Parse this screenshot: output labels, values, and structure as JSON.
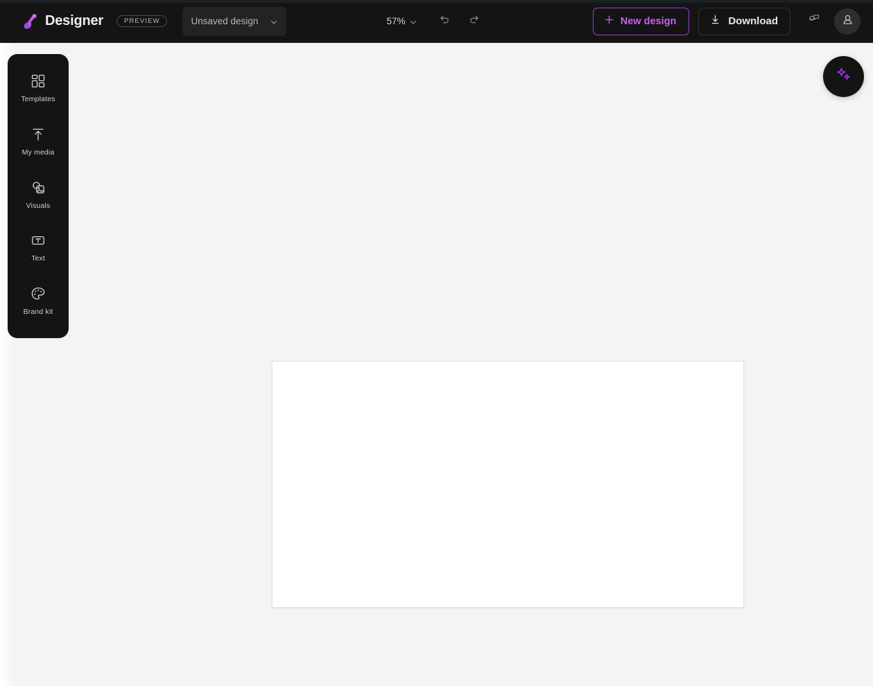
{
  "app": {
    "logo_icon": "designer-logo-icon",
    "name": "Designer",
    "preview_badge": "PREVIEW"
  },
  "topbar": {
    "design_name": "Unsaved design",
    "design_dropdown_icon": "chevron-down-icon",
    "zoom_level": "57%",
    "zoom_dropdown_icon": "chevron-down-icon",
    "undo_icon": "undo-icon",
    "redo_icon": "redo-icon",
    "new_design_label": "New design",
    "new_design_icon": "plus-icon",
    "download_label": "Download",
    "download_icon": "download-icon",
    "feedback_icon": "feedback-chat-icon",
    "avatar_icon": "user-avatar-icon",
    "accent_color": "#cb5cf5",
    "border_accent_color": "#a33ad6",
    "bar_background": "#141414"
  },
  "sidebar": {
    "background": "#141414",
    "items": [
      {
        "label": "Templates",
        "icon": "templates-grid-icon"
      },
      {
        "label": "My media",
        "icon": "upload-arrow-icon"
      },
      {
        "label": "Visuals",
        "icon": "visuals-image-icon"
      },
      {
        "label": "Text",
        "icon": "text-box-icon"
      },
      {
        "label": "Brand kit",
        "icon": "palette-icon"
      }
    ]
  },
  "canvas": {
    "background": "#f4f4f4",
    "page_color": "#ffffff",
    "page_border_color": "#e2e2e2"
  },
  "ai_assistant": {
    "icon": "sparkles-icon",
    "icon_color": "#9b2ee0",
    "background": "#141414"
  }
}
